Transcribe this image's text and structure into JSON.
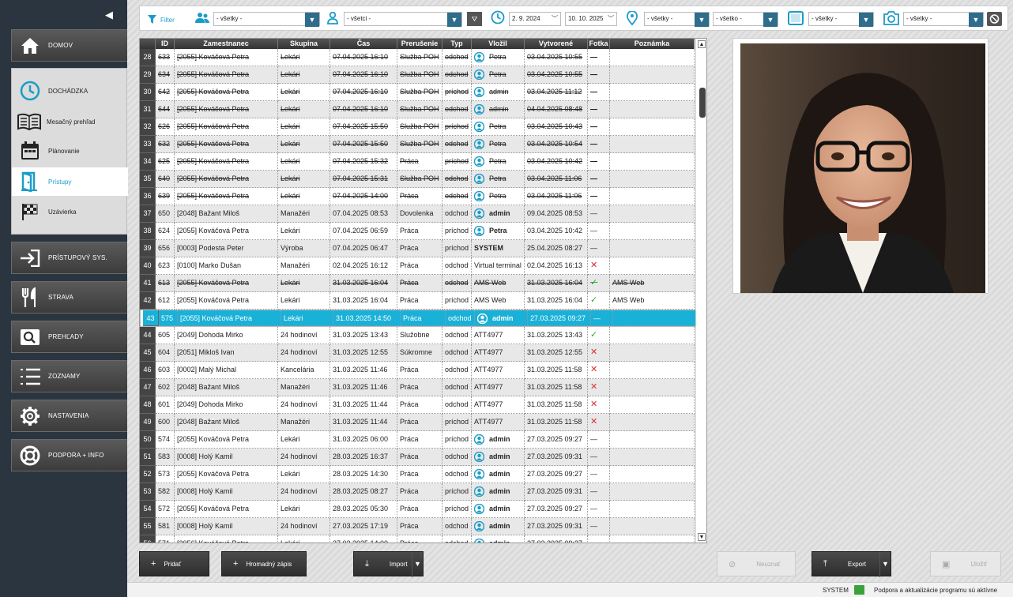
{
  "sidebar": {
    "main_items": [
      {
        "label": "DOMOV",
        "icon": "home-icon"
      },
      {
        "label": "PRÍSTUPOVÝ SYS.",
        "icon": "login-icon"
      },
      {
        "label": "STRAVA",
        "icon": "cutlery-icon"
      },
      {
        "label": "PREHĽADY",
        "icon": "search-icon"
      },
      {
        "label": "ZOZNAMY",
        "icon": "list-icon"
      },
      {
        "label": "NASTAVENIA",
        "icon": "gear-icon"
      },
      {
        "label": "PODPORA + INFO",
        "icon": "lifebuoy-icon"
      }
    ],
    "group_items": [
      {
        "label": "DOCHÁDZKA",
        "icon": "clock-icon"
      },
      {
        "label": "Mesačný prehľad",
        "icon": "book-icon"
      },
      {
        "label": "Plánovanie",
        "icon": "calendar-icon"
      },
      {
        "label": "Prístupy",
        "icon": "door-icon"
      },
      {
        "label": "Uzávierka",
        "icon": "checkered-flag-icon"
      }
    ]
  },
  "filterbar": {
    "filter_label": "Filter",
    "group_select": "- všetky -",
    "employee_select": "- všetci -",
    "date_from": "2. 9. 2024",
    "date_to": "10. 10. 2025",
    "location_select": "- všetky -",
    "location2_select": "- všetko -",
    "device_select": "- všetky -",
    "photo_select": "- všetky -"
  },
  "table": {
    "columns": [
      "ID",
      "Zamestnanec",
      "Skupina",
      "Čas",
      "Prerušenie",
      "Typ",
      "Vložil",
      "Vytvorené",
      "Fotka",
      "Poznámka"
    ],
    "rows": [
      {
        "n": "28",
        "id": "633",
        "emp": "[2055] Kováčová Petra",
        "grp": "Lekári",
        "time": "07.04.2025 16:10",
        "brk": "Služba POH",
        "type": "odchod",
        "by": "Petra",
        "av": true,
        "created": "03.04.2025 10:55",
        "photo": "—",
        "note": "",
        "s": true
      },
      {
        "n": "29",
        "id": "634",
        "emp": "[2055] Kováčová Petra",
        "grp": "Lekári",
        "time": "07.04.2025 16:10",
        "brk": "Služba POH",
        "type": "odchod",
        "by": "Petra",
        "av": true,
        "created": "03.04.2025 10:55",
        "photo": "—",
        "note": "",
        "s": true
      },
      {
        "n": "30",
        "id": "642",
        "emp": "[2055] Kováčová Petra",
        "grp": "Lekári",
        "time": "07.04.2025 16:10",
        "brk": "Služba POH",
        "type": "príchod",
        "by": "admin",
        "av": true,
        "created": "03.04.2025 11:12",
        "photo": "—",
        "note": "",
        "s": true
      },
      {
        "n": "31",
        "id": "644",
        "emp": "[2055] Kováčová Petra",
        "grp": "Lekári",
        "time": "07.04.2025 16:10",
        "brk": "Služba POH",
        "type": "odchod",
        "by": "admin",
        "av": true,
        "created": "04.04.2025 08:48",
        "photo": "—",
        "note": "",
        "s": true
      },
      {
        "n": "32",
        "id": "626",
        "emp": "[2055] Kováčová Petra",
        "grp": "Lekári",
        "time": "07.04.2025 15:50",
        "brk": "Služba POH",
        "type": "príchod",
        "by": "Petra",
        "av": true,
        "created": "03.04.2025 10:43",
        "photo": "—",
        "note": "",
        "s": true
      },
      {
        "n": "33",
        "id": "632",
        "emp": "[2055] Kováčová Petra",
        "grp": "Lekári",
        "time": "07.04.2025 15:50",
        "brk": "Služba POH",
        "type": "odchod",
        "by": "Petra",
        "av": true,
        "created": "03.04.2025 10:54",
        "photo": "—",
        "note": "",
        "s": true
      },
      {
        "n": "34",
        "id": "625",
        "emp": "[2055] Kováčová Petra",
        "grp": "Lekári",
        "time": "07.04.2025 15:32",
        "brk": "Práca",
        "type": "príchod",
        "by": "Petra",
        "av": true,
        "created": "03.04.2025 10:42",
        "photo": "—",
        "note": "",
        "s": true
      },
      {
        "n": "35",
        "id": "640",
        "emp": "[2055] Kováčová Petra",
        "grp": "Lekári",
        "time": "07.04.2025 15:31",
        "brk": "Služba POH",
        "type": "odchod",
        "by": "Petra",
        "av": true,
        "created": "03.04.2025 11:06",
        "photo": "—",
        "note": "",
        "s": true
      },
      {
        "n": "36",
        "id": "639",
        "emp": "[2055] Kováčová Petra",
        "grp": "Lekári",
        "time": "07.04.2025 14:00",
        "brk": "Práca",
        "type": "odchod",
        "by": "Petra",
        "av": true,
        "created": "03.04.2025 11:06",
        "photo": "—",
        "note": "",
        "s": true
      },
      {
        "n": "37",
        "id": "650",
        "emp": "[2048] Bažant Miloš",
        "grp": "Manažéri",
        "time": "07.04.2025 08:53",
        "brk": "Dovolenka",
        "type": "odchod",
        "by": "admin",
        "av": true,
        "b": true,
        "created": "09.04.2025 08:53",
        "photo": "—",
        "note": ""
      },
      {
        "n": "38",
        "id": "624",
        "emp": "[2055] Kováčová Petra",
        "grp": "Lekári",
        "time": "07.04.2025 06:59",
        "brk": "Práca",
        "type": "príchod",
        "by": "Petra",
        "av": true,
        "b": true,
        "created": "03.04.2025 10:42",
        "photo": "—",
        "note": ""
      },
      {
        "n": "39",
        "id": "656",
        "emp": "[0003] Podesta Peter",
        "grp": "Výroba",
        "time": "07.04.2025 06:47",
        "brk": "Práca",
        "type": "príchod",
        "by": "SYSTEM",
        "b": true,
        "created": "25.04.2025 08:27",
        "photo": "—",
        "note": ""
      },
      {
        "n": "40",
        "id": "623",
        "emp": "[0100] Marko Dušan",
        "grp": "Manažéri",
        "time": "02.04.2025 16:12",
        "brk": "Práca",
        "type": "odchod",
        "by": "Virtual terminal",
        "created": "02.04.2025 16:13",
        "photo": "✕",
        "note": ""
      },
      {
        "n": "41",
        "id": "613",
        "emp": "[2055] Kováčová Petra",
        "grp": "Lekári",
        "time": "31.03.2025 16:04",
        "brk": "Práca",
        "type": "odchod",
        "by": "AMS Web",
        "created": "31.03.2025 16:04",
        "photo": "✓",
        "note": "AMS Web",
        "s": true
      },
      {
        "n": "42",
        "id": "612",
        "emp": "[2055] Kováčová Petra",
        "grp": "Lekári",
        "time": "31.03.2025 16:04",
        "brk": "Práca",
        "type": "príchod",
        "by": "AMS Web",
        "created": "31.03.2025 16:04",
        "photo": "✓",
        "note": "AMS Web"
      },
      {
        "n": "43",
        "id": "575",
        "emp": "[2055] Kováčová Petra",
        "grp": "Lekári",
        "time": "31.03.2025 14:50",
        "brk": "Práca",
        "type": "odchod",
        "by": "admin",
        "av": true,
        "b": true,
        "created": "27.03.2025 09:27",
        "photo": "—",
        "note": "",
        "sel": true
      },
      {
        "n": "44",
        "id": "605",
        "emp": "[2049] Dohoda Mirko",
        "grp": "24 hodinoví",
        "time": "31.03.2025 13:43",
        "brk": "Služobne",
        "type": "odchod",
        "by": "ATT4977",
        "created": "31.03.2025 13:43",
        "photo": "✓",
        "note": ""
      },
      {
        "n": "45",
        "id": "604",
        "emp": "[2051] Mikloš Ivan",
        "grp": "24 hodinoví",
        "time": "31.03.2025 12:55",
        "brk": "Súkromne",
        "type": "odchod",
        "by": "ATT4977",
        "created": "31.03.2025 12:55",
        "photo": "✕",
        "note": ""
      },
      {
        "n": "46",
        "id": "603",
        "emp": "[0002] Malý Michal",
        "grp": "Kancelária",
        "time": "31.03.2025 11:46",
        "brk": "Práca",
        "type": "odchod",
        "by": "ATT4977",
        "created": "31.03.2025 11:58",
        "photo": "✕",
        "note": ""
      },
      {
        "n": "47",
        "id": "602",
        "emp": "[2048] Bažant Miloš",
        "grp": "Manažéri",
        "time": "31.03.2025 11:46",
        "brk": "Práca",
        "type": "odchod",
        "by": "ATT4977",
        "created": "31.03.2025 11:58",
        "photo": "✕",
        "note": ""
      },
      {
        "n": "48",
        "id": "601",
        "emp": "[2049] Dohoda Mirko",
        "grp": "24 hodinoví",
        "time": "31.03.2025 11:44",
        "brk": "Práca",
        "type": "odchod",
        "by": "ATT4977",
        "created": "31.03.2025 11:58",
        "photo": "✕",
        "note": ""
      },
      {
        "n": "49",
        "id": "600",
        "emp": "[2048] Bažant Miloš",
        "grp": "Manažéri",
        "time": "31.03.2025 11:44",
        "brk": "Práca",
        "type": "príchod",
        "by": "ATT4977",
        "created": "31.03.2025 11:58",
        "photo": "✕",
        "note": ""
      },
      {
        "n": "50",
        "id": "574",
        "emp": "[2055] Kováčová Petra",
        "grp": "Lekári",
        "time": "31.03.2025 06:00",
        "brk": "Práca",
        "type": "príchod",
        "by": "admin",
        "av": true,
        "b": true,
        "created": "27.03.2025 09:27",
        "photo": "—",
        "note": ""
      },
      {
        "n": "51",
        "id": "583",
        "emp": "[0008] Holý Kamil",
        "grp": "24 hodinoví",
        "time": "28.03.2025 16:37",
        "brk": "Práca",
        "type": "odchod",
        "by": "admin",
        "av": true,
        "b": true,
        "created": "27.03.2025 09:31",
        "photo": "—",
        "note": ""
      },
      {
        "n": "52",
        "id": "573",
        "emp": "[2055] Kováčová Petra",
        "grp": "Lekári",
        "time": "28.03.2025 14:30",
        "brk": "Práca",
        "type": "odchod",
        "by": "admin",
        "av": true,
        "b": true,
        "created": "27.03.2025 09:27",
        "photo": "—",
        "note": ""
      },
      {
        "n": "53",
        "id": "582",
        "emp": "[0008] Holý Kamil",
        "grp": "24 hodinoví",
        "time": "28.03.2025 08:27",
        "brk": "Práca",
        "type": "príchod",
        "by": "admin",
        "av": true,
        "b": true,
        "created": "27.03.2025 09:31",
        "photo": "—",
        "note": ""
      },
      {
        "n": "54",
        "id": "572",
        "emp": "[2055] Kováčová Petra",
        "grp": "Lekári",
        "time": "28.03.2025 05:30",
        "brk": "Práca",
        "type": "príchod",
        "by": "admin",
        "av": true,
        "b": true,
        "created": "27.03.2025 09:27",
        "photo": "—",
        "note": ""
      },
      {
        "n": "55",
        "id": "581",
        "emp": "[0008] Holý Kamil",
        "grp": "24 hodinoví",
        "time": "27.03.2025 17:19",
        "brk": "Práca",
        "type": "odchod",
        "by": "admin",
        "av": true,
        "b": true,
        "created": "27.03.2025 09:31",
        "photo": "—",
        "note": ""
      },
      {
        "n": "56",
        "id": "571",
        "emp": "[2056] Kováčová Petra",
        "grp": "Lekári",
        "time": "27.03.2025 14:00",
        "brk": "Práca",
        "type": "odchod",
        "by": "admin",
        "av": true,
        "b": true,
        "created": "27.03.2025 09:27",
        "photo": "—",
        "note": ""
      }
    ]
  },
  "buttons": {
    "add": "Pridať",
    "bulk": "Hromadný zápis",
    "import": "Import",
    "cancel": "Neuznať",
    "export": "Export",
    "save": "Uložiť"
  },
  "status": {
    "user": "SYSTEM",
    "message": "Podpora a aktualizácie programu sú aktívne"
  },
  "colors": {
    "selected_row": "#1ab1d8",
    "accent": "#1b9cc7",
    "select_button": "#2e6d8c",
    "sidebar": "#2b3540"
  }
}
